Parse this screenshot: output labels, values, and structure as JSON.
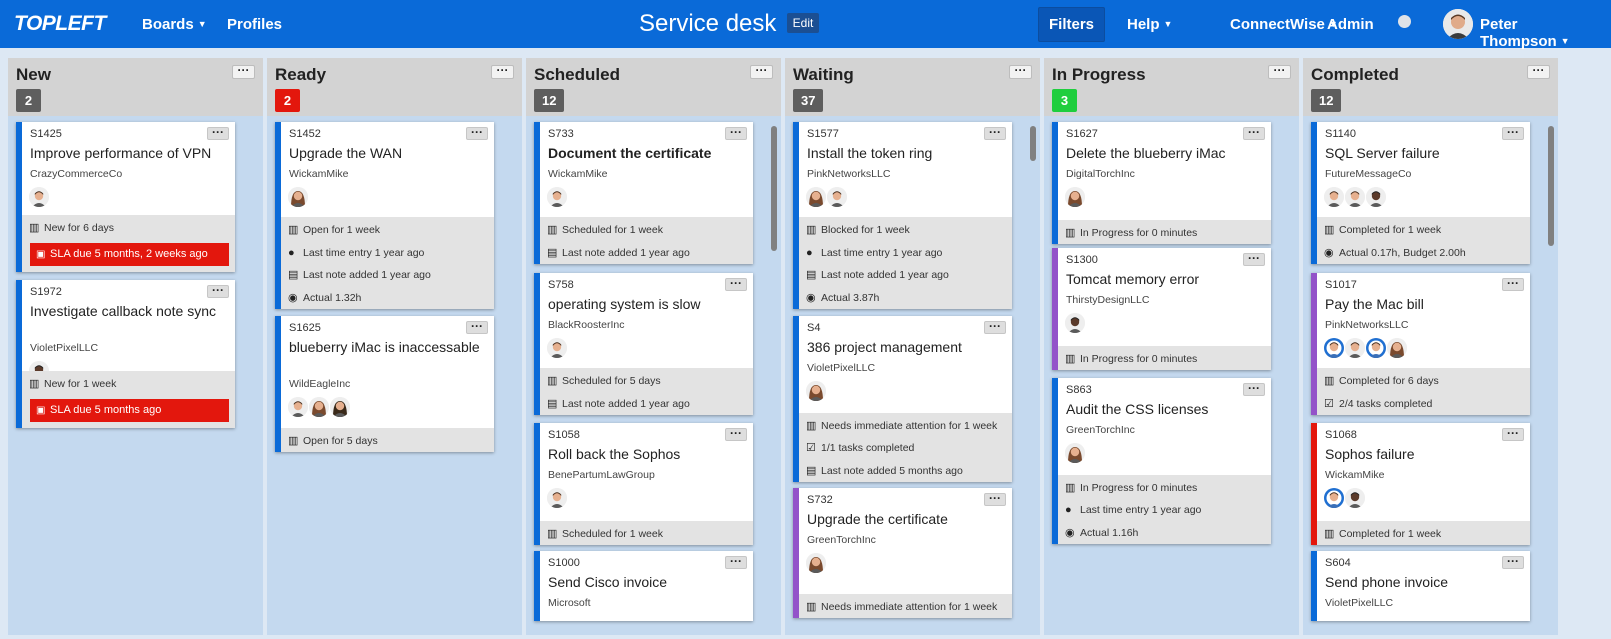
{
  "header": {
    "logo": "TOPLEFT",
    "boards_label": "Boards",
    "profiles_label": "Profiles",
    "title": "Service desk",
    "edit_label": "Edit",
    "filters_label": "Filters",
    "help_label": "Help",
    "connectwise_label": "ConnectWise",
    "admin_label": "Admin",
    "user_name": "Peter Thompson"
  },
  "colors": {
    "brand_blue": "#0a6ad8",
    "bar_blue": "#0a6ad8",
    "bar_purple": "#9353c9",
    "bar_red": "#e3170d",
    "count_grey": "#5e5e5e",
    "count_red": "#e3170d",
    "count_green": "#1fce3e"
  },
  "columns": [
    {
      "title": "New",
      "count": "2",
      "count_color": "grey",
      "cards": [
        {
          "id": "S1425",
          "title": "Improve performance of VPN",
          "company": "CrazyCommerceCo",
          "bar": "blue",
          "statuses": [
            {
              "icon": "board-icon",
              "text": "New for 6 days"
            }
          ],
          "sla": "SLA due 5 months, 2 weeks ago"
        },
        {
          "id": "S1972",
          "title": "Investigate callback note sync",
          "company": "VioletPixelLLC",
          "bar": "blue",
          "statuses": [
            {
              "icon": "board-icon",
              "text": "New for 1 week"
            }
          ],
          "sla": "SLA due 5 months ago"
        }
      ]
    },
    {
      "title": "Ready",
      "count": "2",
      "count_color": "red",
      "cards": [
        {
          "id": "S1452",
          "title": "Upgrade the WAN",
          "company": "WickamMike",
          "bar": "blue",
          "statuses": [
            {
              "icon": "board-icon",
              "text": "Open for 1 week"
            },
            {
              "icon": "clock-icon",
              "text": "Last time entry 1 year ago"
            },
            {
              "icon": "note-icon",
              "text": "Last note added 1 year ago"
            },
            {
              "icon": "stopwatch-icon",
              "text": "Actual 1.32h"
            }
          ]
        },
        {
          "id": "S1625",
          "title": "blueberry iMac is inaccessable",
          "company": "WildEagleInc",
          "bar": "blue",
          "statuses": [
            {
              "icon": "board-icon",
              "text": "Open for 5 days"
            }
          ]
        }
      ]
    },
    {
      "title": "Scheduled",
      "count": "12",
      "count_color": "grey",
      "cards": [
        {
          "id": "S733",
          "title": "Document the certificate",
          "company": "WickamMike",
          "bar": "blue",
          "statuses": [
            {
              "icon": "board-icon",
              "text": "Scheduled for 1 week"
            },
            {
              "icon": "note-icon",
              "text": "Last note added 1 year ago"
            }
          ]
        },
        {
          "id": "S758",
          "title": "operating system is slow",
          "company": "BlackRoosterInc",
          "bar": "blue",
          "statuses": [
            {
              "icon": "board-icon",
              "text": "Scheduled for 5 days"
            },
            {
              "icon": "note-icon",
              "text": "Last note added 1 year ago"
            }
          ]
        },
        {
          "id": "S1058",
          "title": "Roll back the Sophos",
          "company": "BenePartumLawGroup",
          "bar": "blue",
          "statuses": [
            {
              "icon": "board-icon",
              "text": "Scheduled for 1 week"
            }
          ]
        },
        {
          "id": "S1000",
          "title": "Send Cisco invoice",
          "company": "Microsoft",
          "bar": "blue",
          "statuses": []
        }
      ]
    },
    {
      "title": "Waiting",
      "count": "37",
      "count_color": "grey",
      "cards": [
        {
          "id": "S1577",
          "title": "Install the token ring",
          "company": "PinkNetworksLLC",
          "bar": "blue",
          "statuses": [
            {
              "icon": "board-icon",
              "text": "Blocked for 1 week"
            },
            {
              "icon": "clock-icon",
              "text": "Last time entry 1 year ago"
            },
            {
              "icon": "note-icon",
              "text": "Last note added 1 year ago"
            },
            {
              "icon": "stopwatch-icon",
              "text": "Actual 3.87h"
            }
          ]
        },
        {
          "id": "S4",
          "title": "386 project management",
          "company": "VioletPixelLLC",
          "bar": "blue",
          "statuses": [
            {
              "icon": "board-icon",
              "text": "Needs immediate attention for 1 week"
            },
            {
              "icon": "checkbox-icon",
              "text": "1/1 tasks completed"
            },
            {
              "icon": "note-icon",
              "text": "Last note added 5 months ago"
            }
          ]
        },
        {
          "id": "S732",
          "title": "Upgrade the certificate",
          "company": "GreenTorchInc",
          "bar": "purple",
          "statuses": [
            {
              "icon": "board-icon",
              "text": "Needs immediate attention for 1 week"
            }
          ]
        }
      ]
    },
    {
      "title": "In Progress",
      "count": "3",
      "count_color": "green",
      "cards": [
        {
          "id": "S1627",
          "title": "Delete the blueberry iMac",
          "company": "DigitalTorchInc",
          "bar": "blue",
          "statuses": [
            {
              "icon": "board-icon",
              "text": "In Progress for 0 minutes"
            }
          ]
        },
        {
          "id": "S1300",
          "title": "Tomcat memory error",
          "company": "ThirstyDesignLLC",
          "bar": "purple",
          "statuses": [
            {
              "icon": "board-icon",
              "text": "In Progress for 0 minutes"
            }
          ]
        },
        {
          "id": "S863",
          "title": "Audit the CSS licenses",
          "company": "GreenTorchInc",
          "bar": "blue",
          "statuses": [
            {
              "icon": "board-icon",
              "text": "In Progress for 0 minutes"
            },
            {
              "icon": "clock-icon",
              "text": "Last time entry 1 year ago"
            },
            {
              "icon": "stopwatch-icon",
              "text": "Actual 1.16h"
            }
          ]
        }
      ]
    },
    {
      "title": "Completed",
      "count": "12",
      "count_color": "grey",
      "cards": [
        {
          "id": "S1140",
          "title": "SQL Server failure",
          "company": "FutureMessageCo",
          "bar": "blue",
          "statuses": [
            {
              "icon": "board-icon",
              "text": "Completed for 1 week"
            },
            {
              "icon": "stopwatch-icon",
              "text": "Actual 0.17h, Budget 2.00h"
            }
          ]
        },
        {
          "id": "S1017",
          "title": "Pay the Mac bill",
          "company": "PinkNetworksLLC",
          "bar": "purple",
          "statuses": [
            {
              "icon": "board-icon",
              "text": "Completed for 6 days"
            },
            {
              "icon": "checkbox-icon",
              "text": "2/4 tasks completed"
            }
          ]
        },
        {
          "id": "S1068",
          "title": "Sophos failure",
          "company": "WickamMike",
          "bar": "red",
          "statuses": [
            {
              "icon": "board-icon",
              "text": "Completed for 1 week"
            }
          ]
        },
        {
          "id": "S604",
          "title": "Send phone invoice",
          "company": "VioletPixelLLC",
          "bar": "blue",
          "statuses": []
        }
      ]
    }
  ]
}
